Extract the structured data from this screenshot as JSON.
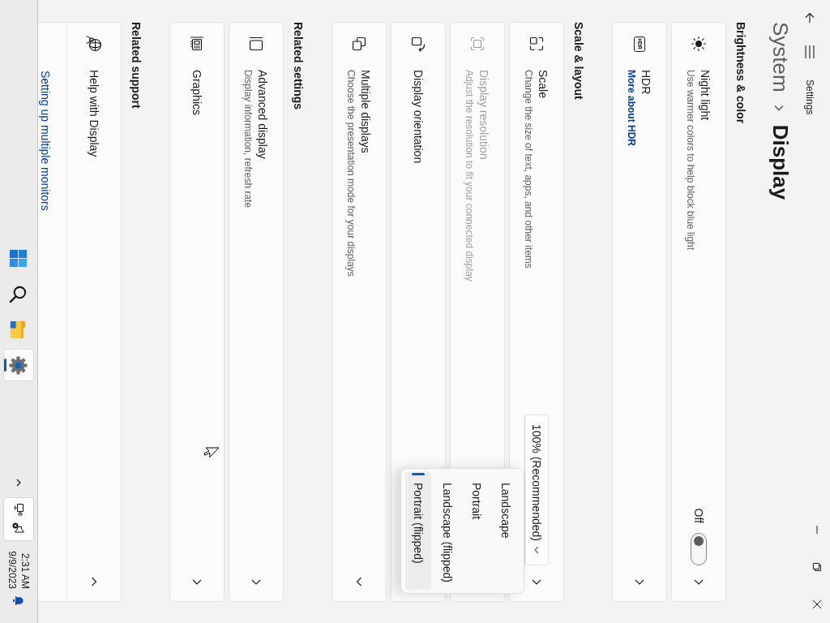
{
  "title_bar": {
    "title": "Settings"
  },
  "breadcrumb": [
    {
      "label": "System"
    },
    {
      "label": "Display"
    }
  ],
  "sections": [
    {
      "heading": "Brightness & color",
      "cards": [
        {
          "kind": "toggle",
          "title": "Night light",
          "subtitle": "Use warmer colors to help block blue light",
          "status": "Off",
          "on": false,
          "disabled": false
        },
        {
          "kind": "nav",
          "title": "HDR",
          "icon_text": "HDR",
          "link": "More about HDR",
          "disabled": false
        }
      ]
    },
    {
      "heading": "Scale & layout",
      "cards": [
        {
          "kind": "dropdown",
          "title": "Scale",
          "subtitle": "Change the size of text, apps, and other items",
          "value": "100% (Recommended)",
          "disabled": false
        },
        {
          "kind": "setting",
          "title": "Display resolution",
          "subtitle": "Adjust the resolution to fit your connected display",
          "disabled": true
        },
        {
          "kind": "menu",
          "title": "Display orientation",
          "disabled": false,
          "options": [
            {
              "label": "Landscape",
              "selected": false
            },
            {
              "label": "Portrait",
              "selected": false
            },
            {
              "label": "Landscape (flipped)",
              "selected": false
            },
            {
              "label": "Portrait (flipped)",
              "selected": true
            }
          ]
        },
        {
          "kind": "expander",
          "title": "Multiple displays",
          "subtitle": "Choose the presentation mode for your displays",
          "expanded": false,
          "disabled": false
        }
      ]
    },
    {
      "heading": "Related settings",
      "cards": [
        {
          "kind": "nav",
          "title": "Advanced display",
          "subtitle": "Display information, refresh rate",
          "disabled": false
        },
        {
          "kind": "nav",
          "title": "Graphics",
          "disabled": false
        }
      ]
    },
    {
      "heading": "Related support",
      "cards": [
        {
          "kind": "expander",
          "title": "Help with Display",
          "expanded": true,
          "links": [
            "Setting up multiple monitors"
          ],
          "disabled": false
        }
      ]
    }
  ],
  "taskbar": {
    "apps": [
      {
        "selected": false
      },
      {
        "selected": false
      },
      {
        "selected": false
      },
      {
        "selected": true
      }
    ],
    "tray": {
      "highlighted": true
    },
    "time": "2:31 AM",
    "date": "9/9/2023"
  }
}
